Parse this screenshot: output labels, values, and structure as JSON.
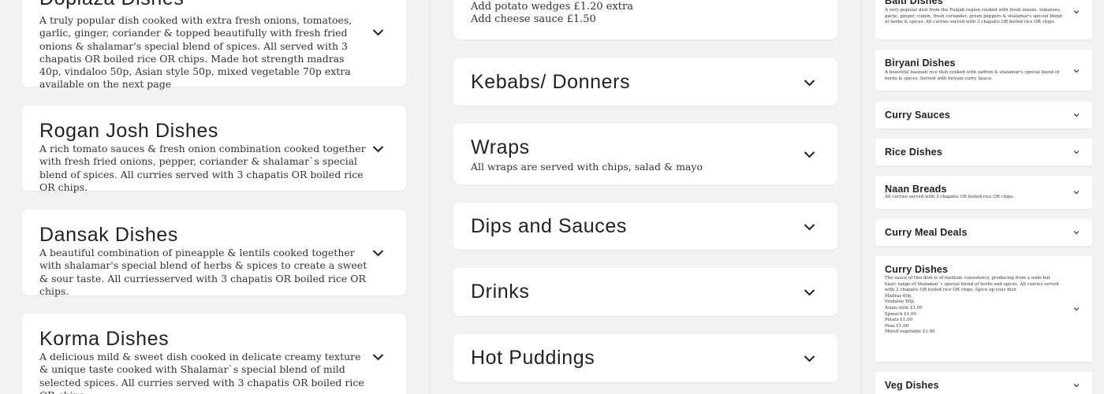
{
  "col1": {
    "cards": [
      {
        "title": "Dopiaza Dishes",
        "description": "A truly popular dish cooked with extra fresh onions, tomatoes, garlic, ginger, coriander & topped beautifully with fresh fried onions & shalamar's special blend of spices. All served with 3 chapatis OR boiled rice OR chips. Made hot strength madras 40p, vindaloo 50p, Asian style 50p, mixed vegetable 70p extra available on the next page"
      },
      {
        "title": "Rogan Josh Dishes",
        "description": "A rich tomato sauces & fresh onion combination cooked together with fresh fried onions, pepper, coriander & shalamar`s special blend of spices. All curries served with 3 chapatis OR boiled rice OR chips."
      },
      {
        "title": "Dansak Dishes",
        "description": "A beautiful combination of pineapple & lentils cooked together with shalamar's special blend of herbs & spices to create a sweet & sour taste. All curriesserved with 3 chapatis OR boiled rice OR chips."
      },
      {
        "title": "Korma Dishes",
        "description": "A delicious mild & sweet dish cooked in delicate creamy texture & unique taste cooked with Shalamar`s special blend of mild selected spices. All curries served with 3 chapatis OR boiled rice OR chips."
      }
    ]
  },
  "col2": {
    "top_card_lines": [
      "Add potato wedges £1.20 extra",
      "Add cheese sauce £1.50"
    ],
    "cards": [
      {
        "title": "Kebabs/ Donners",
        "description": ""
      },
      {
        "title": "Wraps",
        "description": "All wraps are served with chips, salad & mayo"
      },
      {
        "title": "Dips and Sauces",
        "description": ""
      },
      {
        "title": "Drinks",
        "description": ""
      },
      {
        "title": "Hot Puddings",
        "description": ""
      }
    ]
  },
  "col3": {
    "top_card": {
      "title": "Balti Dishes",
      "description": "A very popular dish from the Punjab region cooked with fresh onions, tomatoes, garlic, ginger, cumin, fresh coriander, green peppers & shalamar's special blend of herbs & spices. All curries served with 3 chapatis OR boiled rice OR chips."
    },
    "biryani": {
      "title": "Biryani Dishes",
      "description": "A beautiful basmati rice dish cooked with saffron & shalamar's special blend of herbs & spices. Served with biryani curry Sauce."
    },
    "curry_sauces": {
      "title": "Curry Sauces"
    },
    "rice": {
      "title": "Rice Dishes"
    },
    "naan": {
      "title": "Naan Breads",
      "description": "All curries served with 3 chapatis OR boiled rice OR chips."
    },
    "meal_deals": {
      "title": "Curry Meal Deals"
    },
    "curry": {
      "title": "Curry Dishes",
      "description": "The sauce of this dish is of medium consistency, producing from a wide but basic range of Shalamar`s special blend of herbs and spices. All curries served with 3 chapatis OR boiled rice OR chips. Spice up your dish",
      "extras": [
        "Madras 60p,",
        "Vindaloo 80p,",
        "Asian style £1.00",
        "Spinach £1.00",
        "Potato £1.00",
        "Peas £1.00",
        "Mixed vegetable £1.00"
      ]
    },
    "veg": {
      "title": "Veg Dishes"
    }
  },
  "colors": {
    "background": "#ececec",
    "card": "#ffffff",
    "text": "#2d2d2d"
  },
  "icons": {
    "expand": "chevron-down-icon"
  }
}
